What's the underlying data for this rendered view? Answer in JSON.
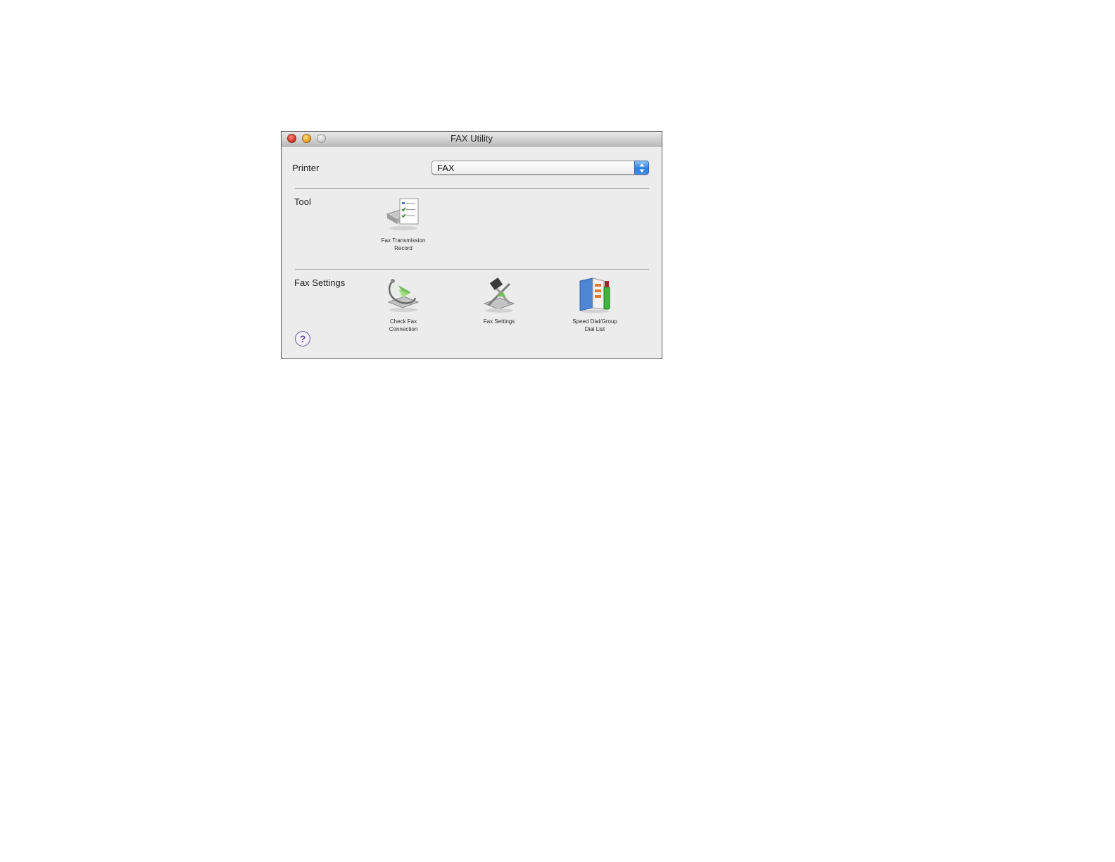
{
  "window": {
    "title": "FAX Utility"
  },
  "printer": {
    "label": "Printer",
    "selected": "FAX"
  },
  "tool_section": {
    "label": "Tool",
    "items": [
      {
        "label": "Fax Transmission\nRecord",
        "icon": "fax-transmission-record-icon"
      }
    ]
  },
  "fax_settings_section": {
    "label": "Fax Settings",
    "items": [
      {
        "label": "Check Fax\nConnection",
        "icon": "check-fax-connection-icon"
      },
      {
        "label": "Fax Settings",
        "icon": "fax-settings-icon"
      },
      {
        "label": "Speed Dial/Group\nDial List",
        "icon": "speed-dial-list-icon"
      }
    ]
  },
  "help": {
    "glyph": "?"
  },
  "colors": {
    "window_bg": "#ececec",
    "titlebar": "#c8c8c8",
    "select_accent": "#2e7fe0"
  }
}
